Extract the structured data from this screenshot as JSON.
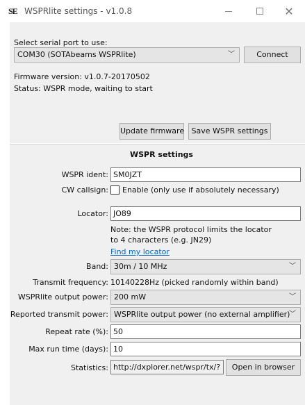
{
  "window": {
    "title": "WSPRlite settings - v1.0.8",
    "icon_text": "SE"
  },
  "serial": {
    "label": "Select serial port to use:",
    "selected_port": "COM30 (SOTAbeams WSPRlite)",
    "connect_label": "Connect"
  },
  "device": {
    "firmware": "Firmware version: v1.0.7-20170502",
    "status": "Status: WSPR mode, waiting to start"
  },
  "actions": {
    "update_firmware": "Update firmware",
    "save_settings": "Save WSPR settings"
  },
  "wspr": {
    "heading": "WSPR settings",
    "ident_label": "WSPR ident:",
    "ident_value": "SM0JZT",
    "cw_label": "CW callsign:",
    "cw_checkbox_label": "Enable (only use if absolutely necessary)",
    "cw_checked": false,
    "locator_label": "Locator:",
    "locator_value": "JO89",
    "locator_note_line1": "Note: the WSPR protocol limits the locator",
    "locator_note_line2": "to 4 characters (e.g. JN29)",
    "find_locator_link": "Find my locator",
    "band_label": "Band:",
    "band_value": "30m / 10 MHz",
    "tx_freq_label": "Transmit frequency:",
    "tx_freq_value": "10140228Hz  (picked randomly within band)",
    "output_power_label": "WSPRlite output power:",
    "output_power_value": "200 mW",
    "reported_power_label": "Reported transmit power:",
    "reported_power_value": "WSPRlite output power (no external amplifier)",
    "repeat_label": "Repeat rate (%):",
    "repeat_value": "50",
    "max_run_label": "Max run time (days):",
    "max_run_value": "10",
    "stats_label": "Statistics:",
    "stats_url": "http://dxplorer.net/wspr/tx/?",
    "open_browser_label": "Open in browser"
  }
}
